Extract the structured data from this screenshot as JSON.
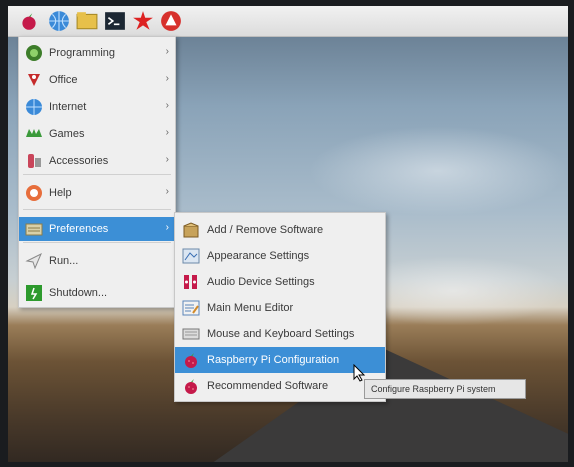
{
  "taskbar": {
    "icons": [
      "raspberry-menu-icon",
      "globe-icon",
      "file-manager-icon",
      "terminal-icon",
      "mathematica-icon",
      "wolfram-icon"
    ]
  },
  "menu": {
    "items": [
      {
        "label": "Programming",
        "icon": "programming-icon",
        "submenu": true
      },
      {
        "label": "Office",
        "icon": "office-icon",
        "submenu": true
      },
      {
        "label": "Internet",
        "icon": "internet-icon",
        "submenu": true
      },
      {
        "label": "Games",
        "icon": "games-icon",
        "submenu": true
      },
      {
        "label": "Accessories",
        "icon": "accessories-icon",
        "submenu": true
      },
      {
        "label": "Help",
        "icon": "help-icon",
        "submenu": true
      },
      {
        "label": "Preferences",
        "icon": "preferences-icon",
        "submenu": true,
        "active": true
      },
      {
        "label": "Run...",
        "icon": "run-icon",
        "submenu": false
      },
      {
        "label": "Shutdown...",
        "icon": "shutdown-icon",
        "submenu": false
      }
    ],
    "arrow": "›"
  },
  "submenu": {
    "items": [
      {
        "label": "Add / Remove Software",
        "icon": "package-icon"
      },
      {
        "label": "Appearance Settings",
        "icon": "appearance-icon"
      },
      {
        "label": "Audio Device Settings",
        "icon": "audio-icon"
      },
      {
        "label": "Main Menu Editor",
        "icon": "menu-editor-icon"
      },
      {
        "label": "Mouse and Keyboard Settings",
        "icon": "keyboard-icon"
      },
      {
        "label": "Raspberry Pi Configuration",
        "icon": "raspberry-icon",
        "active": true
      },
      {
        "label": "Recommended Software",
        "icon": "raspberry-icon"
      }
    ]
  },
  "tooltip": {
    "text": "Configure Raspberry Pi system"
  },
  "colors": {
    "highlight": "#3c8fd6",
    "menu_bg": "#efefef",
    "raspberry": "#c51a4a"
  }
}
